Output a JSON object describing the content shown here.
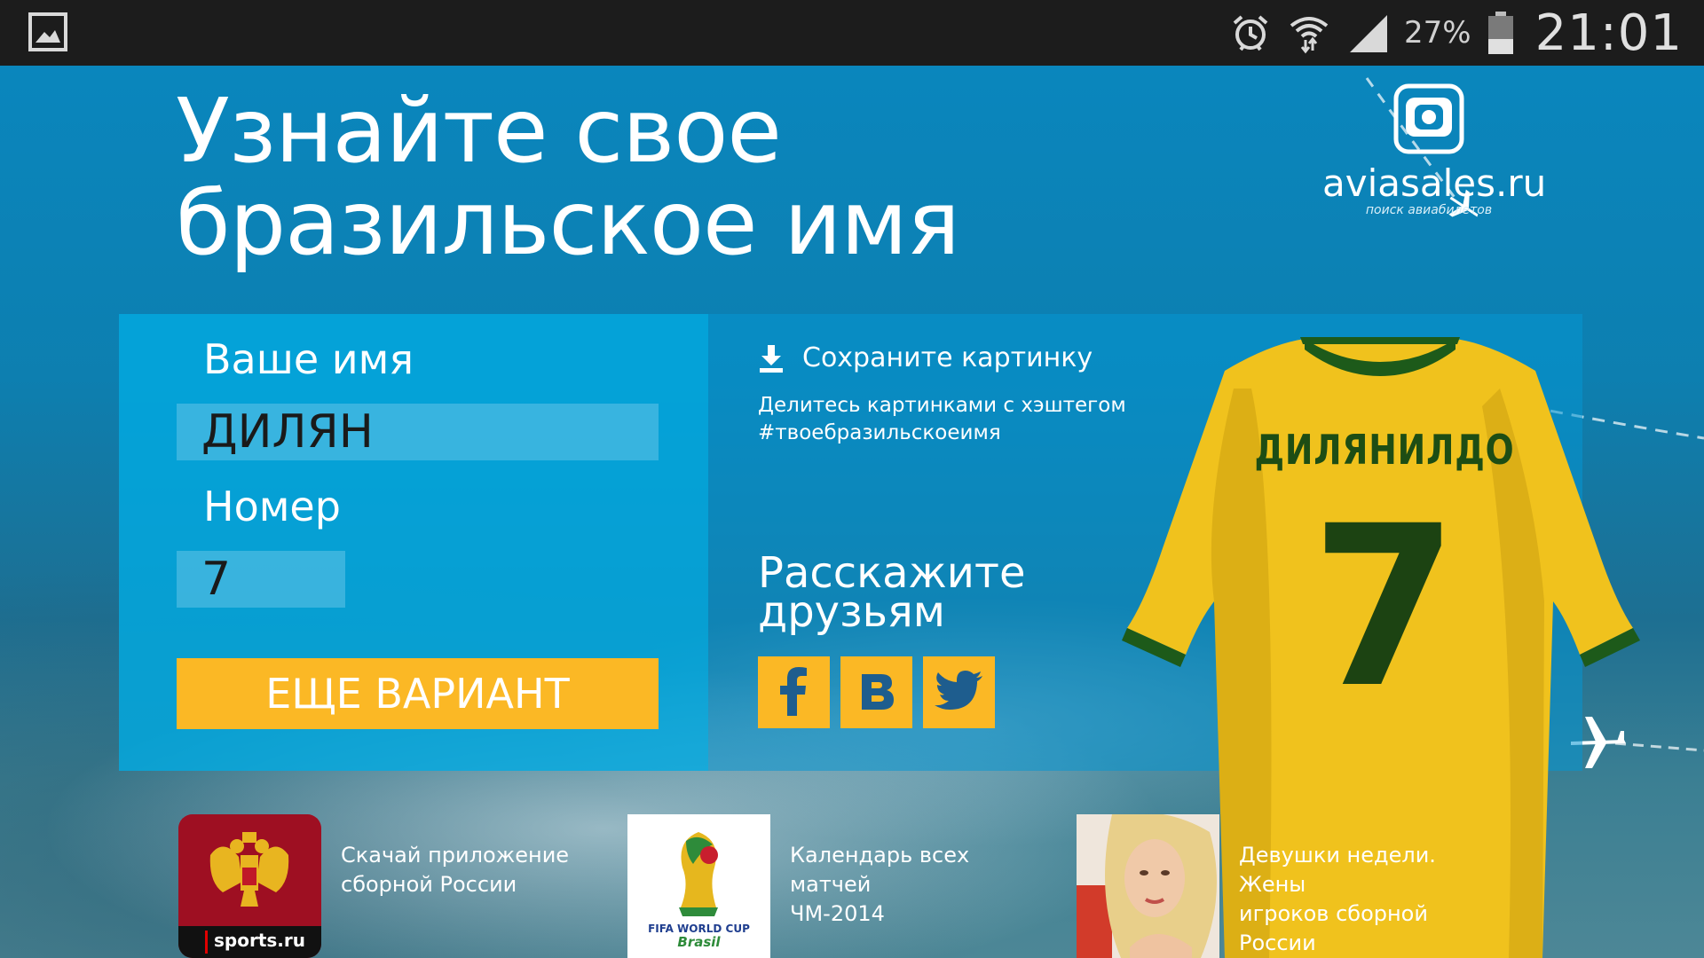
{
  "status_bar": {
    "battery": "27%",
    "time": "21:01",
    "icons": [
      "gallery-icon",
      "alarm-icon",
      "wifi-icon",
      "signal-icon",
      "battery-icon"
    ]
  },
  "header": {
    "title_line1": "Узнайте свое",
    "title_line2": "бразильское имя"
  },
  "logo": {
    "name": "aviasales.ru",
    "subtitle": "поиск авиабилетов"
  },
  "form": {
    "name_label": "Ваше имя",
    "name_value": "ДИЛЯН",
    "number_label": "Номер",
    "number_value": "7",
    "more_button": "ЕЩЕ ВАРИАНТ"
  },
  "share": {
    "save_label": "Сохраните картинку",
    "note_line1": "Делитесь картинками с хэштегом",
    "note_line2": "#твоебразильскоеимя",
    "tell_line1": "Расскажите",
    "tell_line2": "друзьям",
    "networks": [
      "facebook",
      "vk",
      "twitter"
    ]
  },
  "jersey": {
    "name": "ДИЛЯНИЛДО",
    "number": "7"
  },
  "promos": [
    {
      "thumb_caption": "sports.ru",
      "line1": "Скачай приложение",
      "line2": "сборной России"
    },
    {
      "thumb_caption_line1": "FIFA WORLD CUP",
      "thumb_caption_line2": "Brasil",
      "line1": "Календарь всех матчей",
      "line2": "ЧМ-2014"
    },
    {
      "line1": "Девушки недели. Жены",
      "line2": "игроков сборной России"
    }
  ],
  "colors": {
    "accent_yellow": "#fbb825",
    "panel_blue": "#02aae1",
    "jersey_yellow": "#f0c21d",
    "jersey_green": "#1c4312"
  }
}
